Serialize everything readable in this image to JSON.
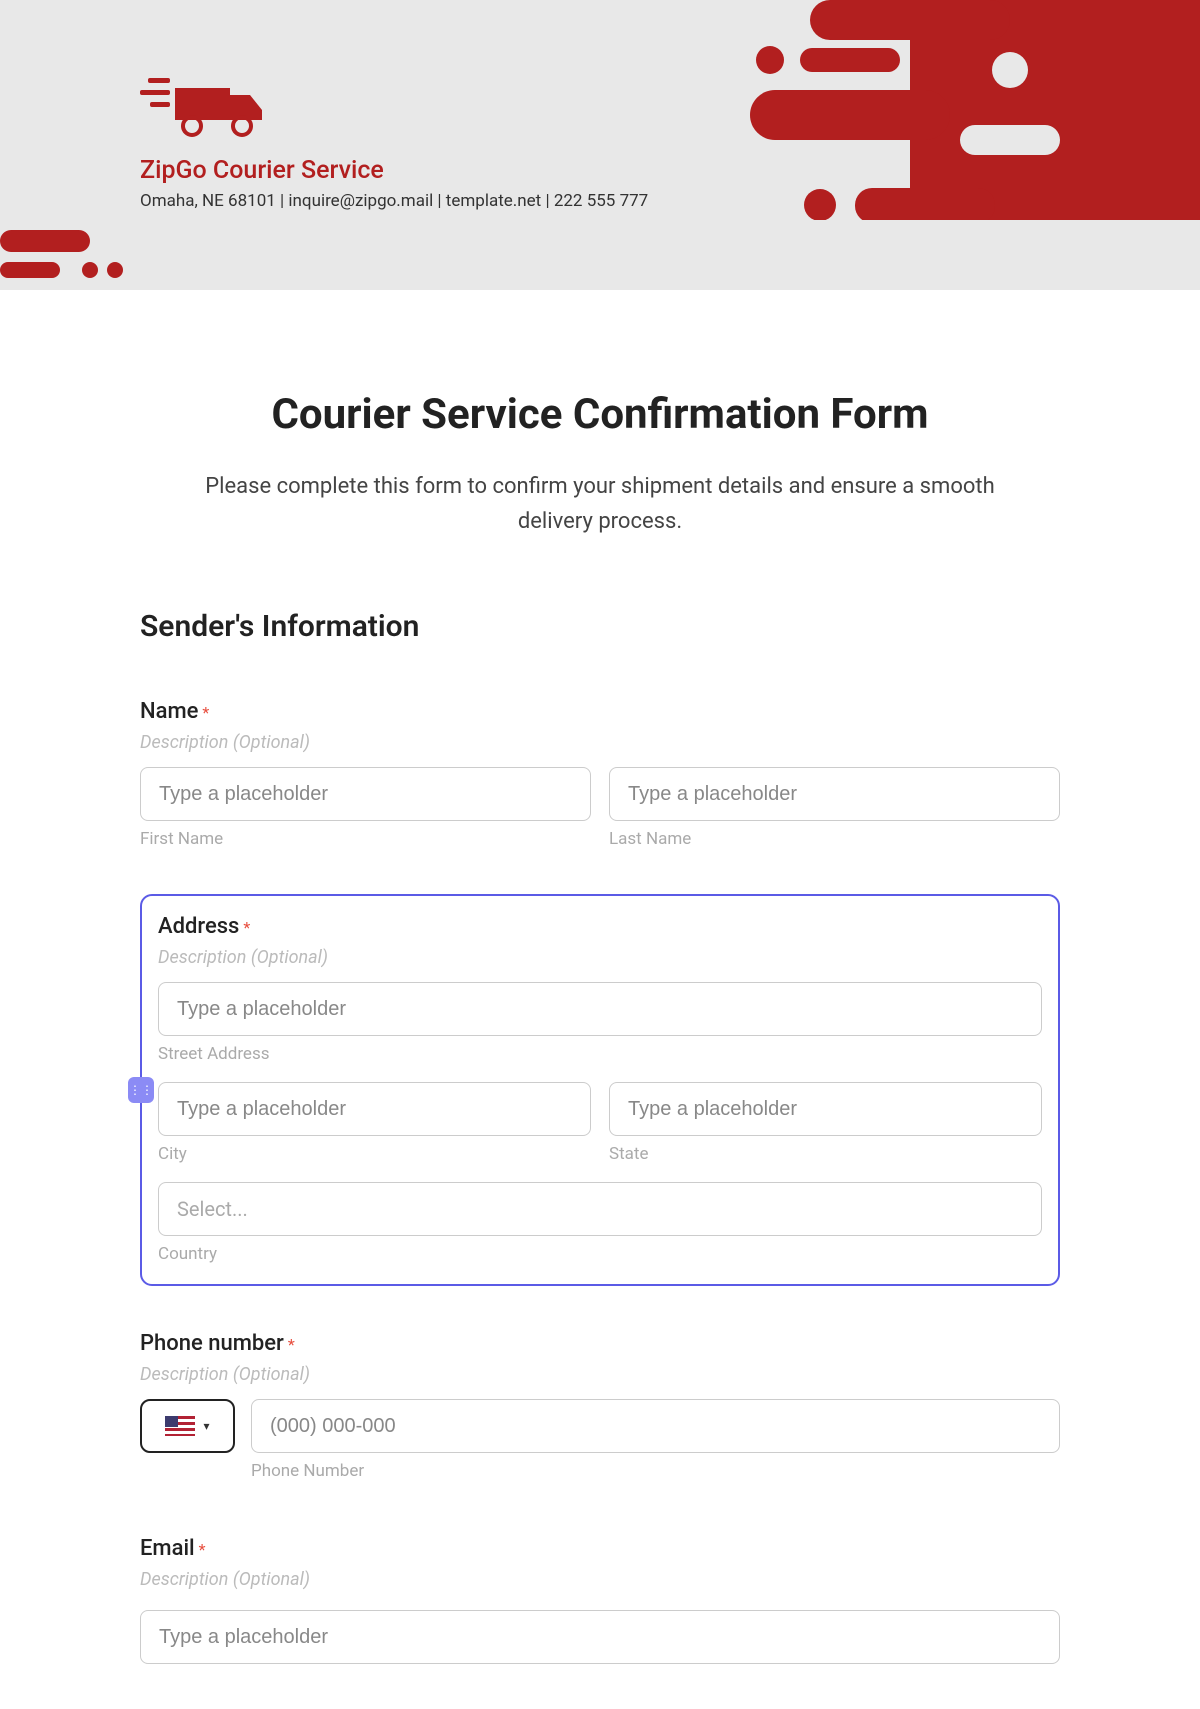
{
  "header": {
    "company_name": "ZipGo Courier Service",
    "contact_line": "Omaha, NE 68101 | inquire@zipgo.mail | template.net | 222 555 777"
  },
  "form": {
    "title": "Courier Service Confirmation Form",
    "subtitle": "Please complete this form to confirm your shipment details and ensure a smooth delivery process.",
    "section1": "Sender's Information",
    "name": {
      "label": "Name",
      "description": "Description (Optional)",
      "first_placeholder": "Type a placeholder",
      "last_placeholder": "Type a placeholder",
      "first_sublabel": "First Name",
      "last_sublabel": "Last Name"
    },
    "address": {
      "label": "Address",
      "description": "Description (Optional)",
      "street_placeholder": "Type a placeholder",
      "street_sublabel": "Street Address",
      "city_placeholder": "Type a placeholder",
      "city_sublabel": "City",
      "state_placeholder": "Type a placeholder",
      "state_sublabel": "State",
      "country_placeholder": "Select...",
      "country_sublabel": "Country"
    },
    "phone": {
      "label": "Phone number",
      "description": "Description (Optional)",
      "placeholder": "(000) 000-000",
      "sublabel": "Phone Number"
    },
    "email": {
      "label": "Email",
      "description": "Description (Optional)",
      "placeholder": "Type a placeholder"
    }
  }
}
